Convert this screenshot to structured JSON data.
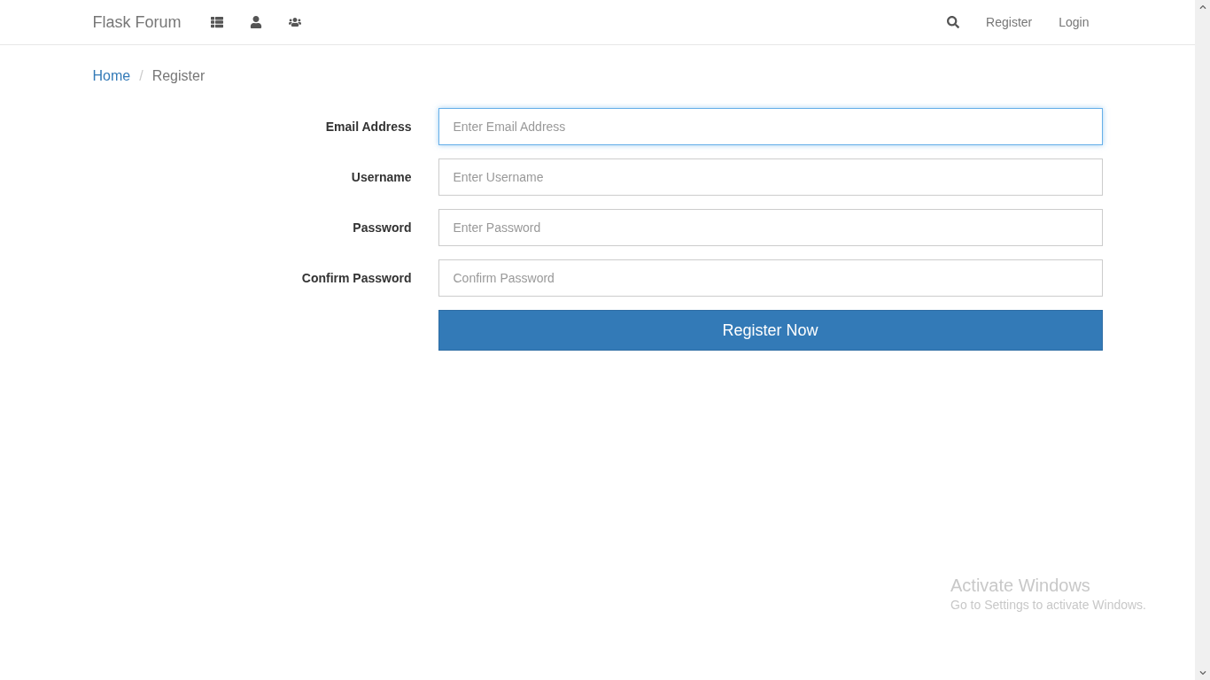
{
  "navbar": {
    "brand": "Flask Forum",
    "icon_links": [
      {
        "kind": "list"
      },
      {
        "kind": "user"
      },
      {
        "kind": "users"
      }
    ],
    "right_icon_links": [
      {
        "kind": "search"
      }
    ],
    "links": [
      "Register",
      "Login"
    ]
  },
  "breadcrumb": {
    "separator": "/",
    "items": [
      {
        "label": "Home",
        "kind": "link"
      },
      {
        "label": "Register",
        "kind": "current"
      }
    ]
  },
  "form": {
    "fields": [
      {
        "label": "Email Address",
        "placeholder": "Enter Email Address",
        "focused": true
      },
      {
        "label": "Username",
        "placeholder": "Enter Username",
        "focused": false
      },
      {
        "label": "Password",
        "placeholder": "Enter Password",
        "focused": false
      },
      {
        "label": "Confirm Password",
        "placeholder": "Confirm Password",
        "focused": false
      }
    ],
    "submit": "Register Now"
  },
  "os_overlay": {
    "title": "Activate Windows",
    "subtitle": "Go to Settings to activate Windows."
  }
}
